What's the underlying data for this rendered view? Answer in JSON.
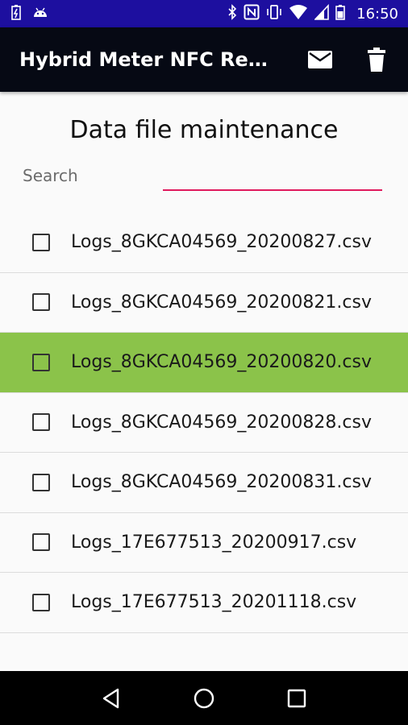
{
  "status_bar": {
    "time": "16:50",
    "left_icons": [
      "battery-saver-icon",
      "android-icon"
    ],
    "right_icons": [
      "bluetooth-icon",
      "nfc-icon",
      "vibrate-icon",
      "wifi-icon",
      "signal-icon",
      "battery-icon"
    ]
  },
  "app_bar": {
    "title": "Hybrid Meter NFC Reader",
    "actions": [
      "email-icon",
      "delete-icon"
    ]
  },
  "page": {
    "heading": "Data file maintenance"
  },
  "search": {
    "label": "Search",
    "value": "",
    "placeholder": ""
  },
  "files": [
    {
      "name": "Logs_8GKCA04569_20200827.csv",
      "checked": false,
      "highlighted": false
    },
    {
      "name": "Logs_8GKCA04569_20200821.csv",
      "checked": false,
      "highlighted": false
    },
    {
      "name": "Logs_8GKCA04569_20200820.csv",
      "checked": false,
      "highlighted": true
    },
    {
      "name": "Logs_8GKCA04569_20200828.csv",
      "checked": false,
      "highlighted": false
    },
    {
      "name": "Logs_8GKCA04569_20200831.csv",
      "checked": false,
      "highlighted": false
    },
    {
      "name": "Logs_17E677513_20200917.csv",
      "checked": false,
      "highlighted": false
    },
    {
      "name": "Logs_17E677513_20201118.csv",
      "checked": false,
      "highlighted": false
    }
  ],
  "nav_bar": {
    "buttons": [
      "back-icon",
      "home-icon",
      "recents-icon"
    ]
  },
  "colors": {
    "status_bar": "#1d0f9f",
    "app_bar": "#060914",
    "highlight": "#8bc34a",
    "search_underline": "#e0195c"
  }
}
